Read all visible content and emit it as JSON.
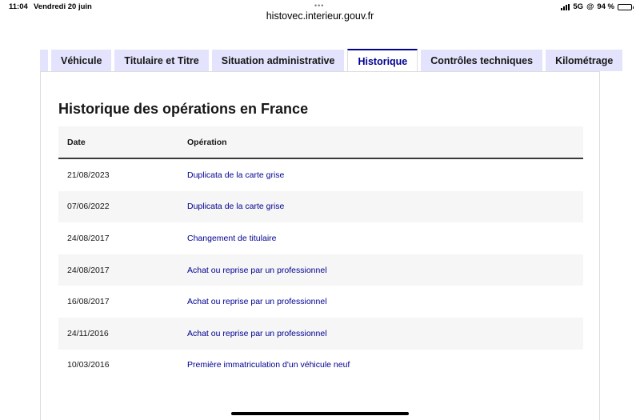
{
  "status_bar": {
    "time": "11:04",
    "date": "Vendredi 20 juin",
    "network": "5G",
    "battery_text": "94 %",
    "battery_level": 0.94
  },
  "browser": {
    "url": "histovec.interieur.gouv.fr"
  },
  "tabs": [
    {
      "label": "Véhicule",
      "active": false
    },
    {
      "label": "Titulaire et Titre",
      "active": false
    },
    {
      "label": "Situation administrative",
      "active": false
    },
    {
      "label": "Historique",
      "active": true
    },
    {
      "label": "Contrôles techniques",
      "active": false
    },
    {
      "label": "Kilométrage",
      "active": false
    }
  ],
  "section": {
    "title": "Historique des opérations en France"
  },
  "table": {
    "headers": {
      "date": "Date",
      "operation": "Opération"
    },
    "rows": [
      {
        "date": "21/08/2023",
        "operation": "Duplicata de la carte grise"
      },
      {
        "date": "07/06/2022",
        "operation": "Duplicata de la carte grise"
      },
      {
        "date": "24/08/2017",
        "operation": "Changement de titulaire"
      },
      {
        "date": "24/08/2017",
        "operation": "Achat ou reprise par un professionnel"
      },
      {
        "date": "16/08/2017",
        "operation": "Achat ou reprise par un professionnel"
      },
      {
        "date": "24/11/2016",
        "operation": "Achat ou reprise par un professionnel"
      },
      {
        "date": "10/03/2016",
        "operation": "Première immatriculation d'un véhicule neuf"
      }
    ]
  },
  "colors": {
    "accent": "#000091",
    "tab_background": "#e3e3fd",
    "stripe": "#f6f6f6",
    "text": "#161616"
  }
}
